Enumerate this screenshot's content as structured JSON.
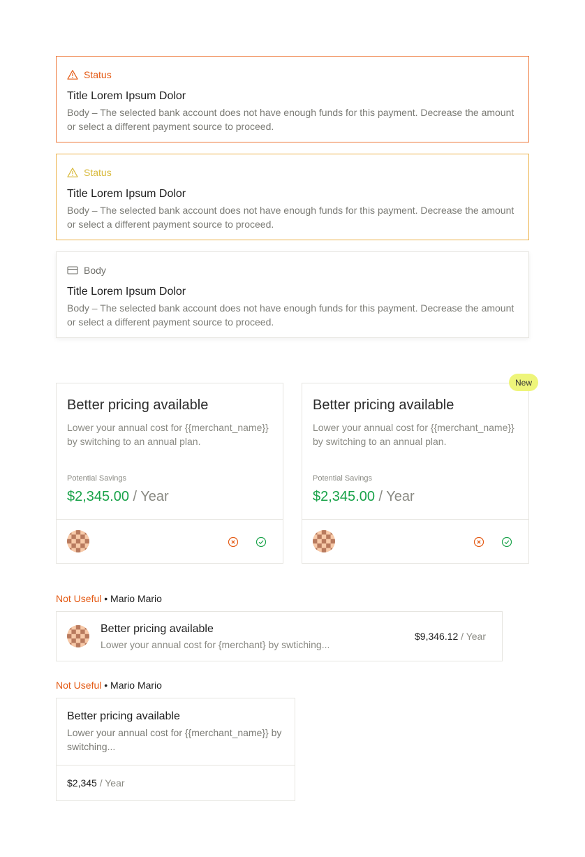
{
  "alerts": [
    {
      "label": "Status",
      "icon": "warning-icon",
      "title": "Title Lorem Ipsum Dolor",
      "body": "Body – The selected bank account does not have enough funds for this payment. Decrease the amount or select a different payment source to proceed.",
      "color": "#e45a14"
    },
    {
      "label": "Status",
      "icon": "warning-icon",
      "title": "Title Lorem Ipsum Dolor",
      "body": "Body – The selected bank account does not have enough funds for this payment. Decrease the amount or select a different payment source to proceed.",
      "color": "#d8b93a"
    },
    {
      "label": "Body",
      "icon": "credit-card-icon",
      "title": "Title Lorem Ipsum Dolor",
      "body": "Body – The selected bank account does not have enough funds for this payment. Decrease the amount or select a different payment source to proceed.",
      "color": "#6f6f6a"
    }
  ],
  "cards": [
    {
      "title": "Better pricing available",
      "description": "Lower your annual cost for {{merchant_name}} by switching to an annual plan.",
      "savings_label": "Potential Savings",
      "amount": "$2,345.00",
      "period": " / Year",
      "icons": [
        "avatar",
        "dismiss-circle-icon",
        "check-circle-icon"
      ]
    },
    {
      "title": "Better pricing available",
      "description": "Lower your annual cost for {{merchant_name}} by switching to an annual plan.",
      "savings_label": "Potential Savings",
      "amount": "$2,345.00",
      "period": " / Year",
      "badge": "New"
    }
  ],
  "feedback_rows": [
    {
      "status": "Not Useful",
      "separator": " • ",
      "user": "Mario Mario",
      "title": "Better pricing available",
      "description": "Lower your annual cost for {merchant} by swtiching...",
      "amount": "$9,346.12",
      "period": " / Year"
    },
    {
      "status": "Not Useful",
      "separator": " • ",
      "user": "Mario Mario",
      "title": "Better pricing available",
      "description": "Lower your annual cost for {{merchant_name}} by switching...",
      "amount": "$2,345",
      "period": " / Year"
    }
  ],
  "colors": {
    "accent_green": "#1aa34a",
    "danger": "#e45a14",
    "warning": "#ecb24a",
    "badge": "#eef57a"
  }
}
